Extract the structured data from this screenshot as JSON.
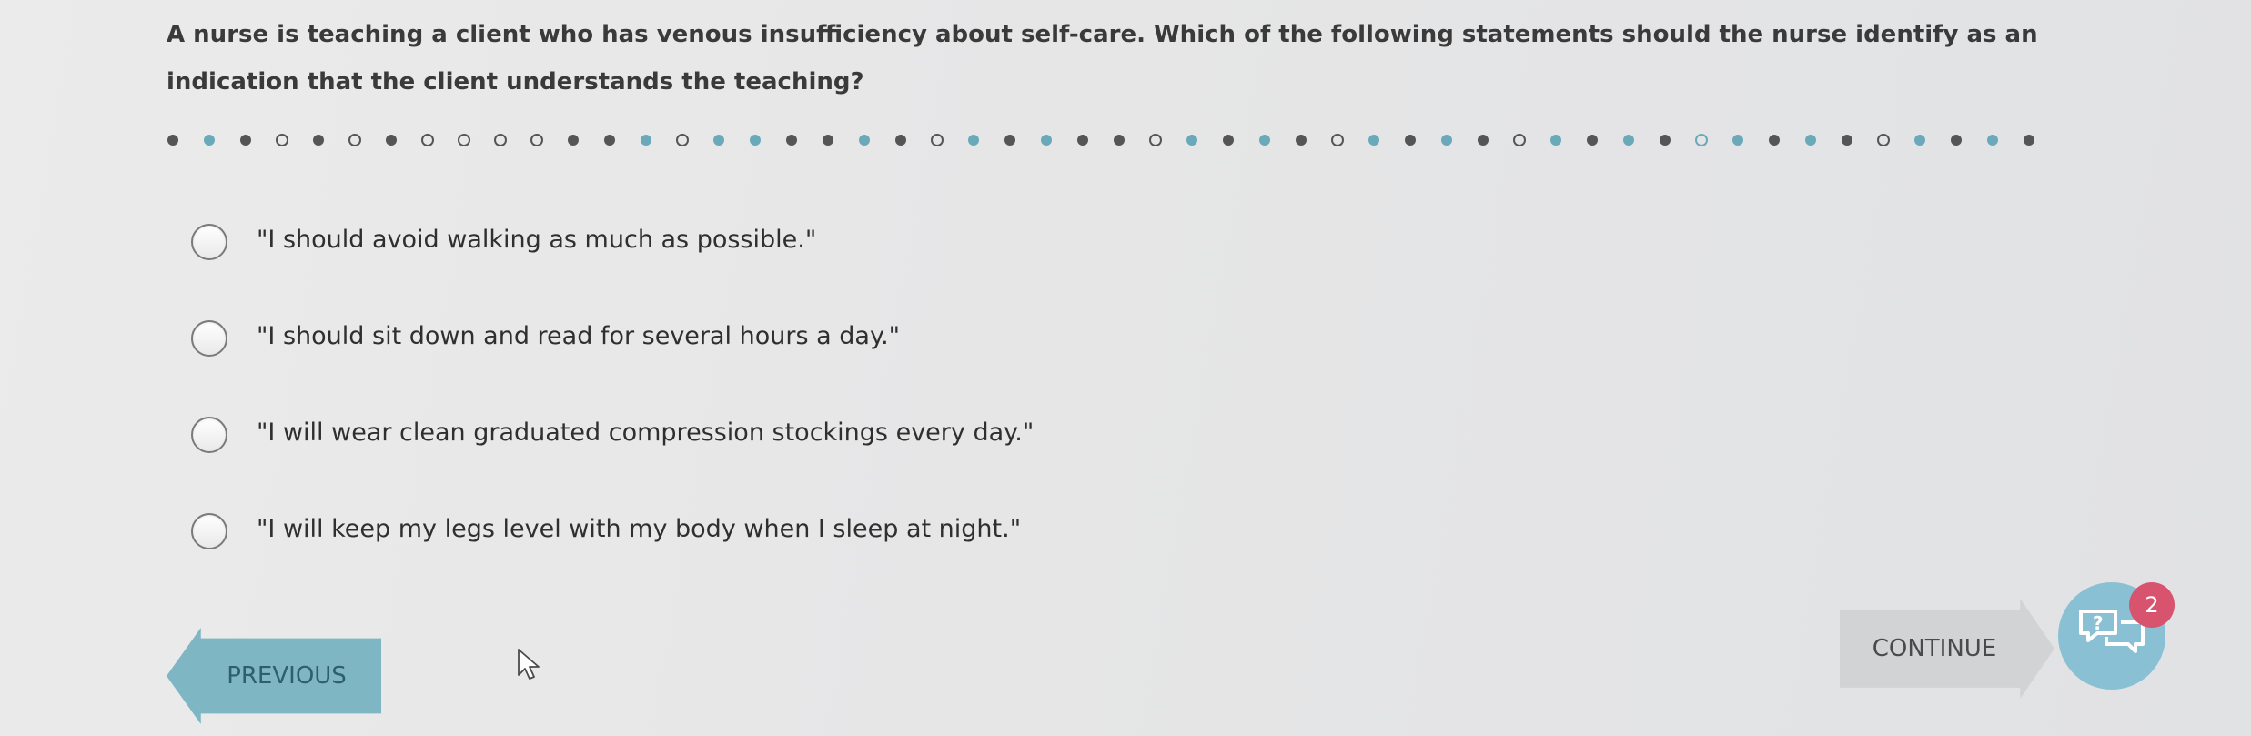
{
  "question": {
    "text": "A nurse is teaching a client who has venous insufficiency about self-care. Which of the following statements should the nurse identify as an indication that the client understands the teaching?"
  },
  "progress": {
    "steps": [
      {
        "style": "filled",
        "color": "#555555"
      },
      {
        "style": "filled",
        "color": "#6aa9b9"
      },
      {
        "style": "filled",
        "color": "#555555"
      },
      {
        "style": "open",
        "color": "#555555"
      },
      {
        "style": "filled",
        "color": "#555555"
      },
      {
        "style": "open",
        "color": "#555555"
      },
      {
        "style": "filled",
        "color": "#555555"
      },
      {
        "style": "open",
        "color": "#555555"
      },
      {
        "style": "open",
        "color": "#555555"
      },
      {
        "style": "open",
        "color": "#555555"
      },
      {
        "style": "open",
        "color": "#555555"
      },
      {
        "style": "filled",
        "color": "#555555"
      },
      {
        "style": "filled",
        "color": "#555555"
      },
      {
        "style": "filled",
        "color": "#6aa9b9"
      },
      {
        "style": "open",
        "color": "#555555"
      },
      {
        "style": "filled",
        "color": "#6aa9b9"
      },
      {
        "style": "filled",
        "color": "#6aa9b9"
      },
      {
        "style": "filled",
        "color": "#555555"
      },
      {
        "style": "filled",
        "color": "#555555"
      },
      {
        "style": "filled",
        "color": "#6aa9b9"
      },
      {
        "style": "filled",
        "color": "#555555"
      },
      {
        "style": "open",
        "color": "#555555"
      },
      {
        "style": "filled",
        "color": "#6aa9b9"
      },
      {
        "style": "filled",
        "color": "#555555"
      },
      {
        "style": "filled",
        "color": "#6aa9b9"
      },
      {
        "style": "filled",
        "color": "#555555"
      },
      {
        "style": "filled",
        "color": "#555555"
      },
      {
        "style": "open",
        "color": "#555555"
      },
      {
        "style": "filled",
        "color": "#6aa9b9"
      },
      {
        "style": "filled",
        "color": "#555555"
      },
      {
        "style": "filled",
        "color": "#6aa9b9"
      },
      {
        "style": "filled",
        "color": "#555555"
      },
      {
        "style": "open",
        "color": "#555555"
      },
      {
        "style": "filled",
        "color": "#6aa9b9"
      },
      {
        "style": "filled",
        "color": "#555555"
      },
      {
        "style": "filled",
        "color": "#6aa9b9"
      },
      {
        "style": "filled",
        "color": "#555555"
      },
      {
        "style": "open",
        "color": "#555555"
      },
      {
        "style": "filled",
        "color": "#6aa9b9"
      },
      {
        "style": "filled",
        "color": "#555555"
      },
      {
        "style": "filled",
        "color": "#6aa9b9"
      },
      {
        "style": "filled",
        "color": "#555555"
      },
      {
        "style": "open",
        "color": "#6aa9b9"
      },
      {
        "style": "filled",
        "color": "#6aa9b9"
      },
      {
        "style": "filled",
        "color": "#555555"
      },
      {
        "style": "filled",
        "color": "#6aa9b9"
      },
      {
        "style": "filled",
        "color": "#555555"
      },
      {
        "style": "open",
        "color": "#555555"
      },
      {
        "style": "filled",
        "color": "#6aa9b9"
      },
      {
        "style": "filled",
        "color": "#555555"
      },
      {
        "style": "filled",
        "color": "#6aa9b9"
      },
      {
        "style": "filled",
        "color": "#555555"
      }
    ]
  },
  "options": [
    {
      "text": "\"I should avoid walking as much as possible.\""
    },
    {
      "text": "\"I should sit down and read for several hours a day.\""
    },
    {
      "text": "\"I will wear clean graduated compression stockings every day.\""
    },
    {
      "text": "\"I will keep my legs level with my body when I sleep at night.\""
    }
  ],
  "nav": {
    "previous_label": "PREVIOUS",
    "continue_label": "CONTINUE"
  },
  "help": {
    "icon": "help-chat-icon",
    "badge_count": "2",
    "badge_color": "#d8536e",
    "accent_color": "#89c0d4"
  }
}
